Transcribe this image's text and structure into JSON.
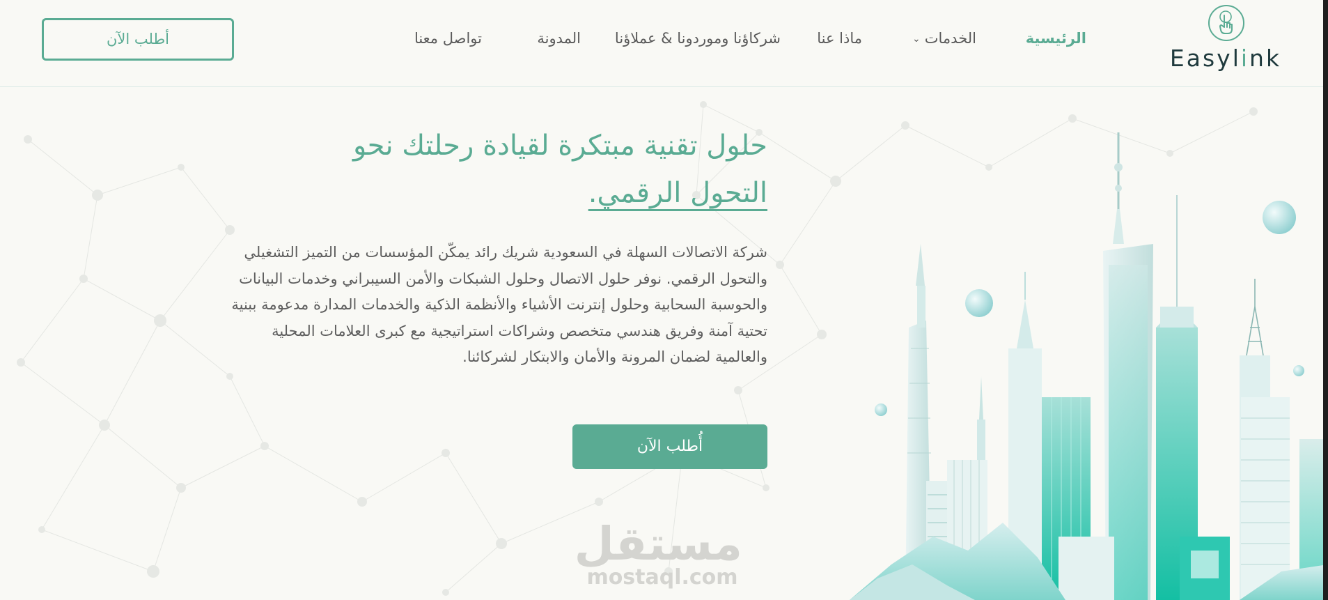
{
  "brand": {
    "name_part1": "Easyl",
    "name_accent": "i",
    "name_part2": "nk",
    "primary_color": "#5aab93",
    "dark_color": "#1f3a3d",
    "logo_icon": "hand-pointer-icon"
  },
  "nav": {
    "items": [
      {
        "label": "الرئيسية",
        "active": true
      },
      {
        "label": "الخدمات",
        "has_dropdown": true,
        "icon": "chevron-down-icon"
      },
      {
        "label": "ماذا عنا"
      },
      {
        "label": "شركاؤنا وموردونا & عملاؤنا"
      },
      {
        "label": "المدونة"
      },
      {
        "label": "تواصل معنا"
      }
    ],
    "cta_label": "أطلب الآن"
  },
  "hero": {
    "title_line1": "حلول تقنية مبتكرة لقيادة رحلتك نحو",
    "title_line2": "التحول الرقمي.",
    "body": "شركة الاتصالات السهلة في السعودية شريك رائد يمكّن المؤسسات من التميز التشغيلي والتحول الرقمي. نوفر حلول الاتصال وحلول الشبكات والأمن السيبراني وخدمات البيانات والحوسبة السحابية وحلول إنترنت الأشياء والأنظمة الذكية والخدمات المدارة مدعومة ببنية تحتية آمنة وفريق هندسي متخصص وشراكات استراتيجية مع كبرى العلامات المحلية والعالمية لضمان المرونة والأمان والابتكار لشركائنا.",
    "cta_label": "أُطلب الآن"
  },
  "watermark": {
    "arabic": "مستقل",
    "latin": "mostaql.com"
  }
}
